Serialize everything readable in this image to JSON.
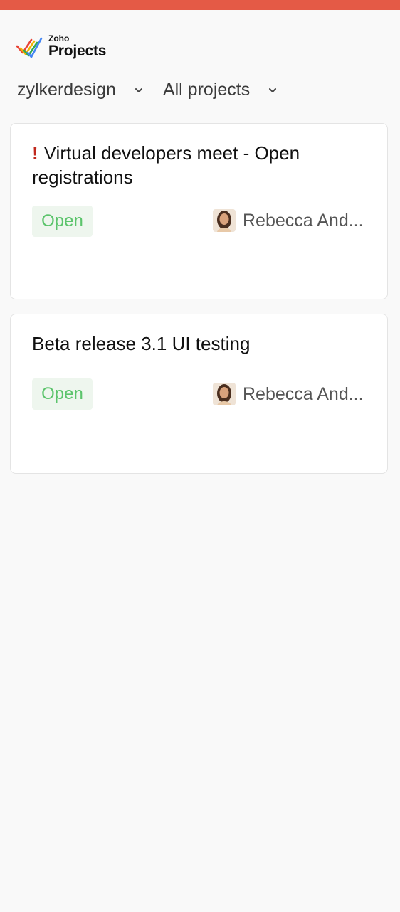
{
  "app": {
    "brand": "Zoho",
    "product": "Projects"
  },
  "filters": {
    "portal": "zylkerdesign",
    "scope": "All projects"
  },
  "tasks": [
    {
      "priority_mark": "!",
      "title": "Virtual developers meet - Open registrations",
      "status": "Open",
      "owner": "Rebecca And..."
    },
    {
      "title": "Beta release 3.1 UI testing",
      "status": "Open",
      "owner": "Rebecca And..."
    }
  ],
  "colors": {
    "accent_bar": "#e45a46",
    "status_open": "#5cc46c",
    "priority_high": "#c0281d"
  },
  "icons": [
    "zoho-projects-logo-icon",
    "chevron-down-icon",
    "avatar"
  ]
}
